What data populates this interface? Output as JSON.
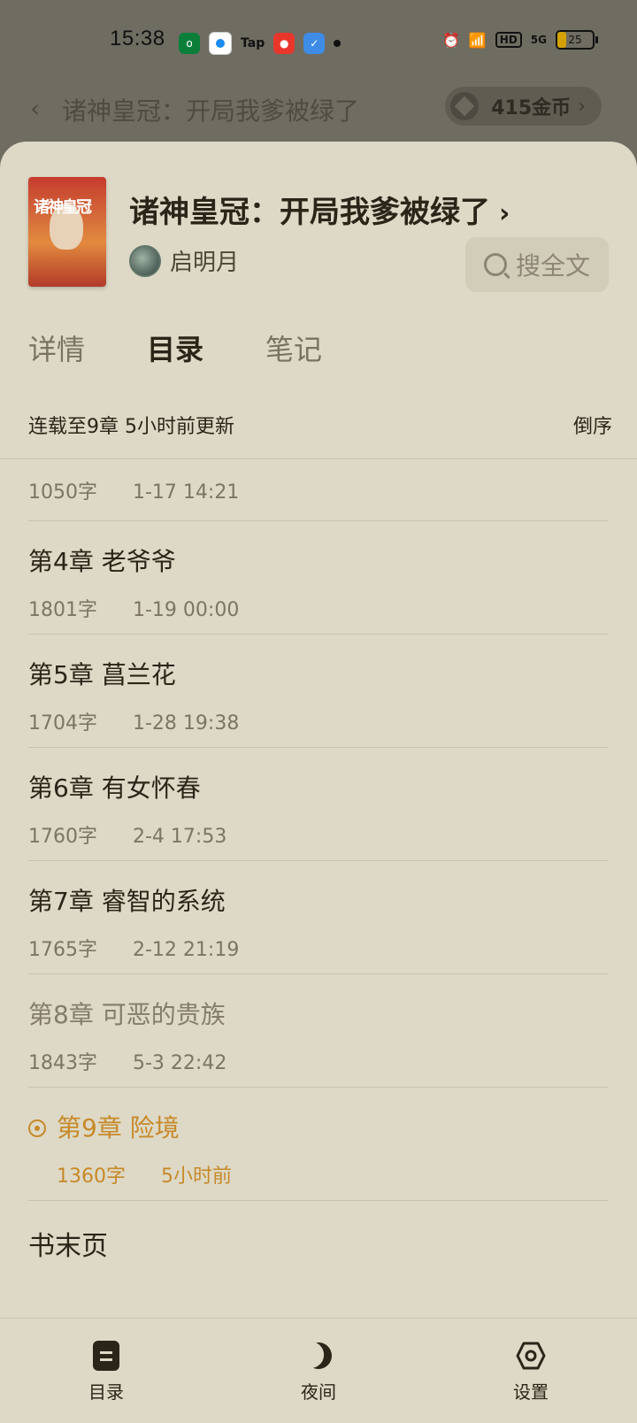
{
  "status_bar": {
    "time": "15:38",
    "app_icons": [
      "oppo-app",
      "circle-app",
      "Tap",
      "red-app",
      "blue-app"
    ],
    "battery": "25",
    "network": "5G",
    "hd": "HD"
  },
  "top_bar": {
    "title": "诸神皇冠：开局我爹被绿了",
    "coins": "415金币"
  },
  "book": {
    "title": "诸神皇冠：开局我爹被绿了",
    "author": "启明月",
    "search_label": "搜全文"
  },
  "tabs": [
    {
      "label": "详情",
      "active": false
    },
    {
      "label": "目录",
      "active": true
    },
    {
      "label": "笔记",
      "active": false
    }
  ],
  "status": {
    "serial": "连载至9章 5小时前更新",
    "sort": "倒序"
  },
  "partial_chapter": {
    "words": "1050字",
    "date": "1-17 14:21"
  },
  "chapters": [
    {
      "title": "第4章 老爷爷",
      "words": "1801字",
      "date": "1-19 00:00"
    },
    {
      "title": "第5章 菖兰花",
      "words": "1704字",
      "date": "1-28 19:38"
    },
    {
      "title": "第6章 有女怀春",
      "words": "1760字",
      "date": "2-4 17:53"
    },
    {
      "title": "第7章 睿智的系统",
      "words": "1765字",
      "date": "2-12 21:19"
    },
    {
      "title": "第8章 可恶的贵族",
      "words": "1843字",
      "date": "5-3 22:42"
    },
    {
      "title": "第9章 险境",
      "words": "1360字",
      "date": "5小时前"
    }
  ],
  "end_page": "书末页",
  "bottom_nav": [
    {
      "label": "目录",
      "icon": "toc-icon"
    },
    {
      "label": "夜间",
      "icon": "moon-icon"
    },
    {
      "label": "设置",
      "icon": "settings-icon"
    }
  ],
  "colors": {
    "sheet_bg": "#ddd9c6",
    "accent": "#c78929",
    "text": "#2b2418"
  }
}
